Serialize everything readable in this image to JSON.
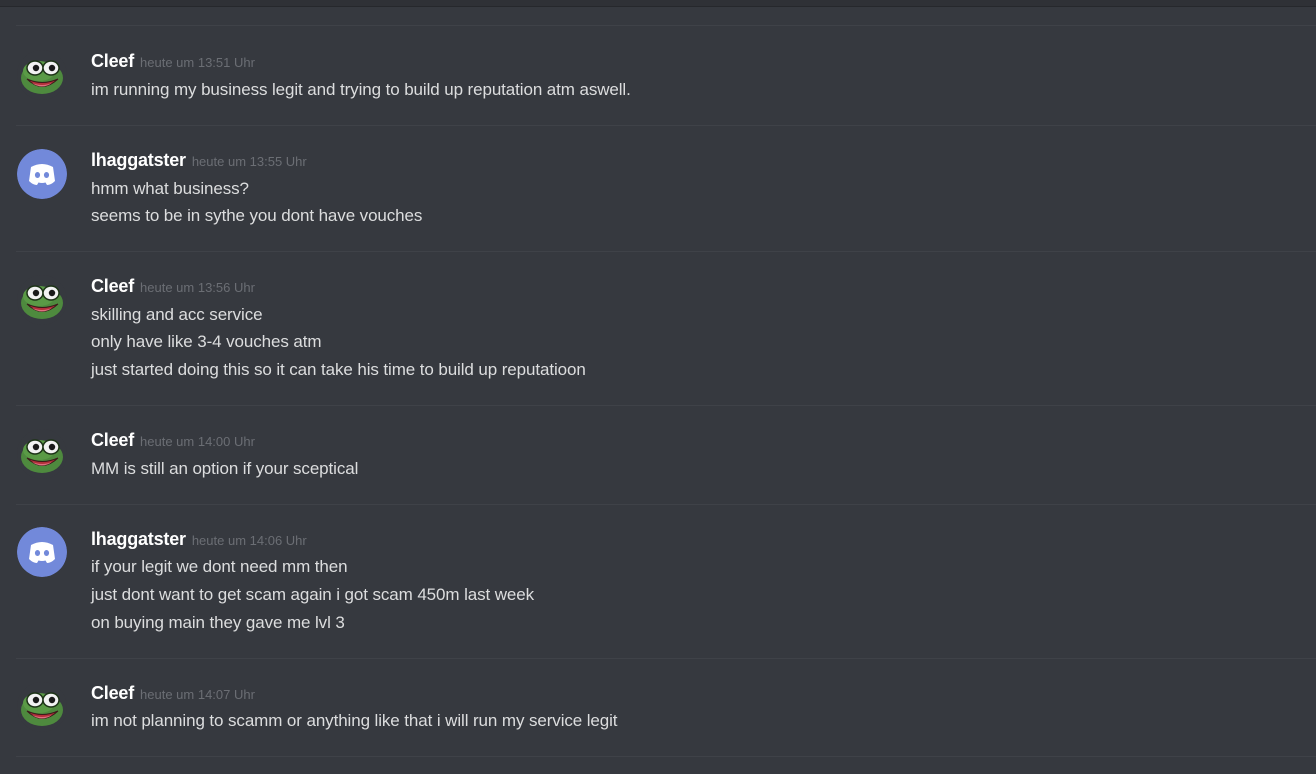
{
  "users": {
    "cleef": {
      "name": "Cleef",
      "avatar_icon": "pepe-frog-icon"
    },
    "lhaggatster": {
      "name": "lhaggatster",
      "avatar_icon": "discord-logo-icon",
      "avatar_color": "#7289da"
    }
  },
  "messages": [
    {
      "author": "Cleef",
      "timestamp": "heute um 13:51 Uhr",
      "lines": [
        "im running my business legit and trying to build up reputation atm aswell."
      ]
    },
    {
      "author": "lhaggatster",
      "timestamp": "heute um 13:55 Uhr",
      "lines": [
        "hmm what business?",
        "seems to be in sythe you dont have vouches"
      ]
    },
    {
      "author": "Cleef",
      "timestamp": "heute um 13:56 Uhr",
      "lines": [
        "skilling and acc service",
        "only have like 3-4 vouches atm",
        "just started doing this so it can take his time to build up reputatioon"
      ]
    },
    {
      "author": "Cleef",
      "timestamp": "heute um 14:00 Uhr",
      "lines": [
        "MM is still an option if your sceptical"
      ]
    },
    {
      "author": "lhaggatster",
      "timestamp": "heute um 14:06 Uhr",
      "lines": [
        "if your legit we dont need mm then",
        "just dont want to get scam again i got scam 450m last week",
        "on buying main they gave me lvl 3"
      ]
    },
    {
      "author": "Cleef",
      "timestamp": "heute um 14:07 Uhr",
      "lines": [
        "im not planning to scamm or anything like that i will run my service legit"
      ]
    }
  ],
  "colors": {
    "background": "#36393f",
    "username": "#ffffff",
    "message_text": "#dcddde",
    "timestamp": "#6b6e74",
    "discord_blurple": "#7289da"
  }
}
